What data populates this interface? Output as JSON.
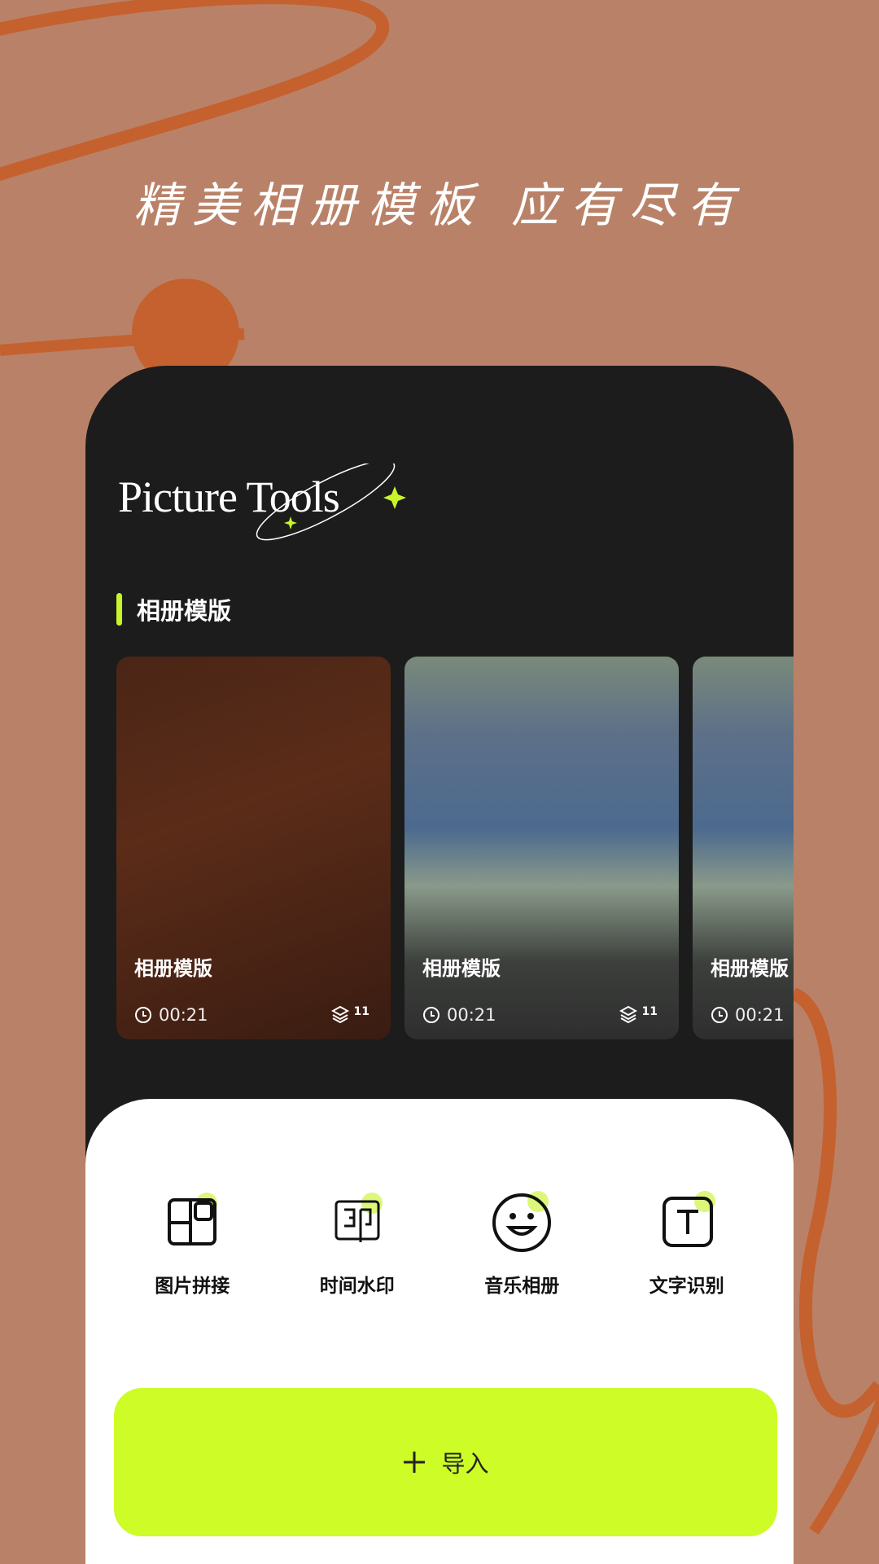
{
  "headline": "精美相册模板 应有尽有",
  "app": {
    "logo": "Picture Tools",
    "section_title": "相册模版",
    "accent": "#cdfc26"
  },
  "templates": [
    {
      "title": "相册模版",
      "duration": "00:21",
      "layers": "11"
    },
    {
      "title": "相册模版",
      "duration": "00:21",
      "layers": "11"
    },
    {
      "title": "相册模版",
      "duration": "00:21"
    }
  ],
  "tools": [
    {
      "label": "图片拼接",
      "icon": "collage-icon"
    },
    {
      "label": "时间水印",
      "icon": "watermark-icon"
    },
    {
      "label": "音乐相册",
      "icon": "smile-icon"
    },
    {
      "label": "文字识别",
      "icon": "text-icon"
    }
  ],
  "import_button": {
    "label": "导入",
    "icon": "plus-icon"
  }
}
